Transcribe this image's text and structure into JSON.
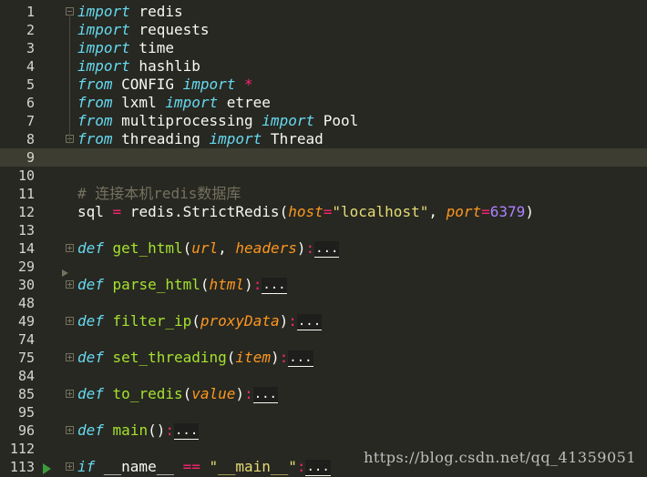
{
  "lines": [
    {
      "n": "1",
      "fold": "open",
      "tokens": [
        [
          "kw",
          "import"
        ],
        [
          "t",
          " redis"
        ]
      ]
    },
    {
      "n": "2",
      "tokens": [
        [
          "kw",
          "import"
        ],
        [
          "t",
          " requests"
        ]
      ]
    },
    {
      "n": "3",
      "tokens": [
        [
          "kw",
          "import"
        ],
        [
          "t",
          " time"
        ]
      ]
    },
    {
      "n": "4",
      "tokens": [
        [
          "kw",
          "import"
        ],
        [
          "t",
          " hashlib"
        ]
      ]
    },
    {
      "n": "5",
      "tokens": [
        [
          "kw",
          "from"
        ],
        [
          "t",
          " CONFIG "
        ],
        [
          "kw",
          "import"
        ],
        [
          "t",
          " "
        ],
        [
          "op",
          "*"
        ]
      ]
    },
    {
      "n": "6",
      "tokens": [
        [
          "kw",
          "from"
        ],
        [
          "t",
          " lxml "
        ],
        [
          "kw",
          "import"
        ],
        [
          "t",
          " etree"
        ]
      ]
    },
    {
      "n": "7",
      "tokens": [
        [
          "kw",
          "from"
        ],
        [
          "t",
          " multiprocessing "
        ],
        [
          "kw",
          "import"
        ],
        [
          "t",
          " Pool"
        ]
      ]
    },
    {
      "n": "8",
      "fold": "end",
      "tokens": [
        [
          "kw",
          "from"
        ],
        [
          "t",
          " threading "
        ],
        [
          "kw",
          "import"
        ],
        [
          "t",
          " Thread"
        ]
      ]
    },
    {
      "n": "9",
      "current": true,
      "tokens": []
    },
    {
      "n": "10",
      "tokens": []
    },
    {
      "n": "11",
      "tokens": [
        [
          "cm",
          "# 连接本机redis数据库"
        ]
      ]
    },
    {
      "n": "12",
      "tokens": [
        [
          "t",
          "sql "
        ],
        [
          "op",
          "="
        ],
        [
          "t",
          " redis.StrictRedis("
        ],
        [
          "param",
          "host"
        ],
        [
          "op",
          "="
        ],
        [
          "str",
          "\"localhost\""
        ],
        [
          "t",
          ", "
        ],
        [
          "param",
          "port"
        ],
        [
          "op",
          "="
        ],
        [
          "num",
          "6379"
        ],
        [
          "t",
          ")"
        ]
      ]
    },
    {
      "n": "13",
      "tokens": []
    },
    {
      "n": "14",
      "fold": "collapsed",
      "tokens": [
        [
          "kw",
          "def"
        ],
        [
          "t",
          " "
        ],
        [
          "fn",
          "get_html"
        ],
        [
          "t",
          "("
        ],
        [
          "param",
          "url"
        ],
        [
          "t",
          ", "
        ],
        [
          "param",
          "headers"
        ],
        [
          "t",
          ")"
        ],
        [
          "op",
          ":"
        ],
        [
          "ellip",
          "..."
        ]
      ]
    },
    {
      "n": "29",
      "tokens": []
    },
    {
      "n": "30",
      "fold": "collapsed",
      "tokens": [
        [
          "kw",
          "def"
        ],
        [
          "t",
          " "
        ],
        [
          "fn",
          "parse_html"
        ],
        [
          "t",
          "("
        ],
        [
          "param",
          "html"
        ],
        [
          "t",
          ")"
        ],
        [
          "op",
          ":"
        ],
        [
          "ellip",
          "..."
        ]
      ]
    },
    {
      "n": "48",
      "tokens": []
    },
    {
      "n": "49",
      "fold": "collapsed",
      "tokens": [
        [
          "kw",
          "def"
        ],
        [
          "t",
          " "
        ],
        [
          "fn",
          "filter_ip"
        ],
        [
          "t",
          "("
        ],
        [
          "param",
          "proxyData"
        ],
        [
          "t",
          ")"
        ],
        [
          "op",
          ":"
        ],
        [
          "ellip",
          "..."
        ]
      ]
    },
    {
      "n": "74",
      "tokens": []
    },
    {
      "n": "75",
      "fold": "collapsed",
      "tokens": [
        [
          "kw",
          "def"
        ],
        [
          "t",
          " "
        ],
        [
          "fn",
          "set_threading"
        ],
        [
          "t",
          "("
        ],
        [
          "param",
          "item"
        ],
        [
          "t",
          ")"
        ],
        [
          "op",
          ":"
        ],
        [
          "ellip",
          "..."
        ]
      ]
    },
    {
      "n": "84",
      "tokens": []
    },
    {
      "n": "85",
      "fold": "collapsed",
      "tokens": [
        [
          "kw",
          "def"
        ],
        [
          "t",
          " "
        ],
        [
          "fn",
          "to_redis"
        ],
        [
          "t",
          "("
        ],
        [
          "param",
          "value"
        ],
        [
          "t",
          ")"
        ],
        [
          "op",
          ":"
        ],
        [
          "ellip",
          "..."
        ]
      ]
    },
    {
      "n": "95",
      "tokens": []
    },
    {
      "n": "96",
      "fold": "collapsed",
      "tokens": [
        [
          "kw",
          "def"
        ],
        [
          "t",
          " "
        ],
        [
          "fn",
          "main"
        ],
        [
          "t",
          "()"
        ],
        [
          "op",
          ":"
        ],
        [
          "ellip",
          "..."
        ]
      ]
    },
    {
      "n": "112",
      "tokens": []
    },
    {
      "n": "113",
      "fold": "collapsed",
      "run": true,
      "tokens": [
        [
          "kw",
          "if"
        ],
        [
          "t",
          " __name__ "
        ],
        [
          "op",
          "=="
        ],
        [
          "t",
          " "
        ],
        [
          "str",
          "\"__main__\""
        ],
        [
          "op",
          ":"
        ],
        [
          "ellip",
          "..."
        ]
      ]
    }
  ],
  "watermark": "https://blog.csdn.net/qq_41359051",
  "colors": {
    "background": "#272822",
    "current_line": "#3e3d32",
    "keyword": "#66d9ef",
    "operator": "#f92672",
    "string": "#e6db74",
    "number": "#ae81ff",
    "parameter": "#fd971f",
    "function": "#a6e22e",
    "comment": "#75715e"
  }
}
